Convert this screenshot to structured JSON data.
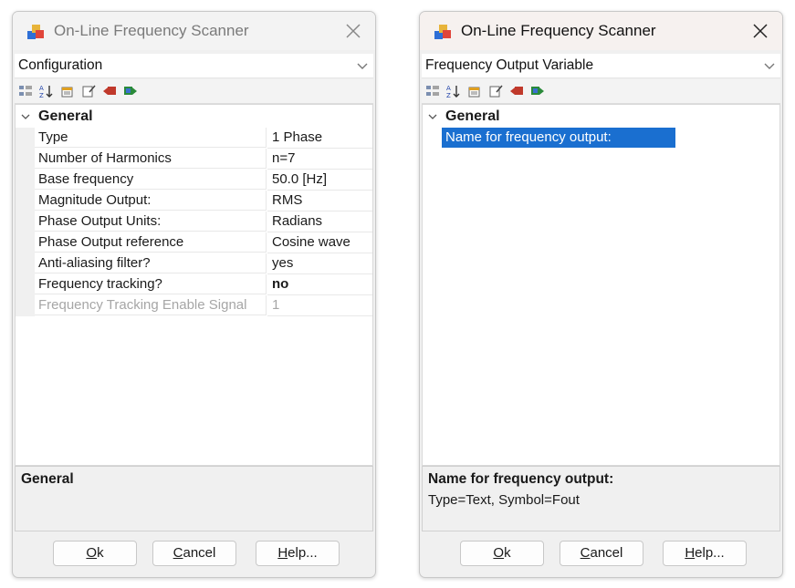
{
  "left_dialog": {
    "title": "On-Line Frequency Scanner",
    "combo_value": "Configuration",
    "category": "General",
    "properties": [
      {
        "name": "Type",
        "value": "1 Phase"
      },
      {
        "name": "Number of Harmonics",
        "value": "n=7"
      },
      {
        "name": "Base frequency",
        "value": "50.0 [Hz]"
      },
      {
        "name": "Magnitude Output:",
        "value": "RMS"
      },
      {
        "name": "Phase Output Units:",
        "value": "Radians"
      },
      {
        "name": "Phase Output reference",
        "value": "Cosine wave"
      },
      {
        "name": "Anti-aliasing filter?",
        "value": "yes"
      },
      {
        "name": "Frequency tracking?",
        "value": "no"
      },
      {
        "name": "Frequency Tracking Enable Signal",
        "value": "1"
      }
    ],
    "help_title": "General",
    "help_desc": "",
    "buttons": {
      "ok": {
        "u": "O",
        "rest": "k"
      },
      "cancel": {
        "u": "C",
        "rest": "ancel"
      },
      "help": {
        "u": "H",
        "rest": "elp..."
      }
    }
  },
  "right_dialog": {
    "title": "On-Line Frequency Scanner",
    "combo_value": "Frequency Output Variable",
    "category": "General",
    "properties": [
      {
        "name": "Name for frequency output:",
        "value": ""
      }
    ],
    "help_title": "Name for frequency output:",
    "help_desc": "Type=Text, Symbol=Fout",
    "buttons": {
      "ok": {
        "u": "O",
        "rest": "k"
      },
      "cancel": {
        "u": "C",
        "rest": "ancel"
      },
      "help": {
        "u": "H",
        "rest": "elp..."
      }
    }
  },
  "icons": {
    "app": "frequency-scanner-app-icon",
    "toolbar": [
      "categorized-icon",
      "sort-alphabetical-icon",
      "property-pages-icon",
      "edit-icon",
      "import-icon",
      "export-icon"
    ]
  },
  "colors": {
    "selection": "#1a6fd0",
    "disabled_text": "#a6a6a6",
    "dialog_bg": "#f0f0f0"
  }
}
